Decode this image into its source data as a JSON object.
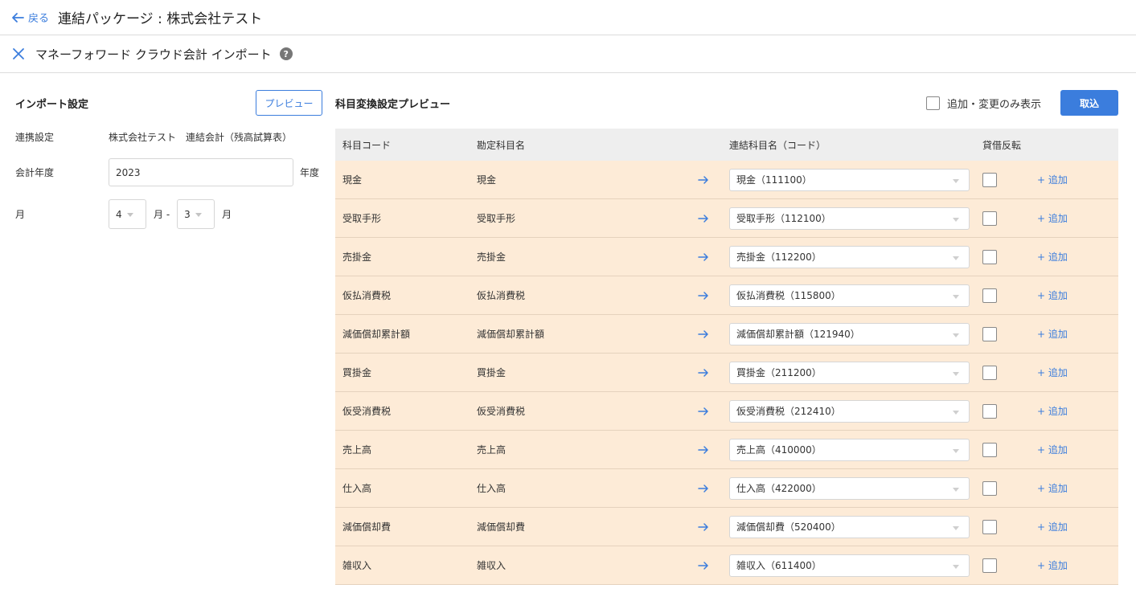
{
  "header": {
    "back_label": "戻る",
    "title": "連結パッケージ : 株式会社テスト"
  },
  "subheader": {
    "title": "マネーフォワード クラウド会計 インポート",
    "help": "?"
  },
  "import_settings": {
    "title": "インポート設定",
    "preview_button": "プレビュー",
    "link_label": "連携設定",
    "link_value": "株式会社テスト　連結会計（残高試算表）",
    "year_label": "会計年度",
    "year_value": "2023",
    "year_unit": "年度",
    "month_label": "月",
    "month_from": "4",
    "month_sep": "月 -",
    "month_to": "3",
    "month_unit": "月"
  },
  "preview": {
    "title": "科目変換設定プレビュー",
    "filter_label": "追加・変更のみ表示",
    "import_button": "取込",
    "columns": {
      "code": "科目コード",
      "name": "勘定科目名",
      "consolidated": "連結科目名（コード）",
      "reverse": "貸借反転"
    },
    "add_label": "+ 追加",
    "rows": [
      {
        "code": "現金",
        "name": "現金",
        "consolidated": "現金（111100）"
      },
      {
        "code": "受取手形",
        "name": "受取手形",
        "consolidated": "受取手形（112100）"
      },
      {
        "code": "売掛金",
        "name": "売掛金",
        "consolidated": "売掛金（112200）"
      },
      {
        "code": "仮払消費税",
        "name": "仮払消費税",
        "consolidated": "仮払消費税（115800）"
      },
      {
        "code": "減価償却累計額",
        "name": "減価償却累計額",
        "consolidated": "減価償却累計額（121940）"
      },
      {
        "code": "買掛金",
        "name": "買掛金",
        "consolidated": "買掛金（211200）"
      },
      {
        "code": "仮受消費税",
        "name": "仮受消費税",
        "consolidated": "仮受消費税（212410）"
      },
      {
        "code": "売上高",
        "name": "売上高",
        "consolidated": "売上高（410000）"
      },
      {
        "code": "仕入高",
        "name": "仕入高",
        "consolidated": "仕入高（422000）"
      },
      {
        "code": "減価償却費",
        "name": "減価償却費",
        "consolidated": "減価償却費（520400）"
      },
      {
        "code": "雑収入",
        "name": "雑収入",
        "consolidated": "雑収入（611400）"
      }
    ]
  },
  "colors": {
    "accent": "#3b7ddd",
    "row_bg": "#fdebd7",
    "header_bg": "#eeeeee"
  }
}
